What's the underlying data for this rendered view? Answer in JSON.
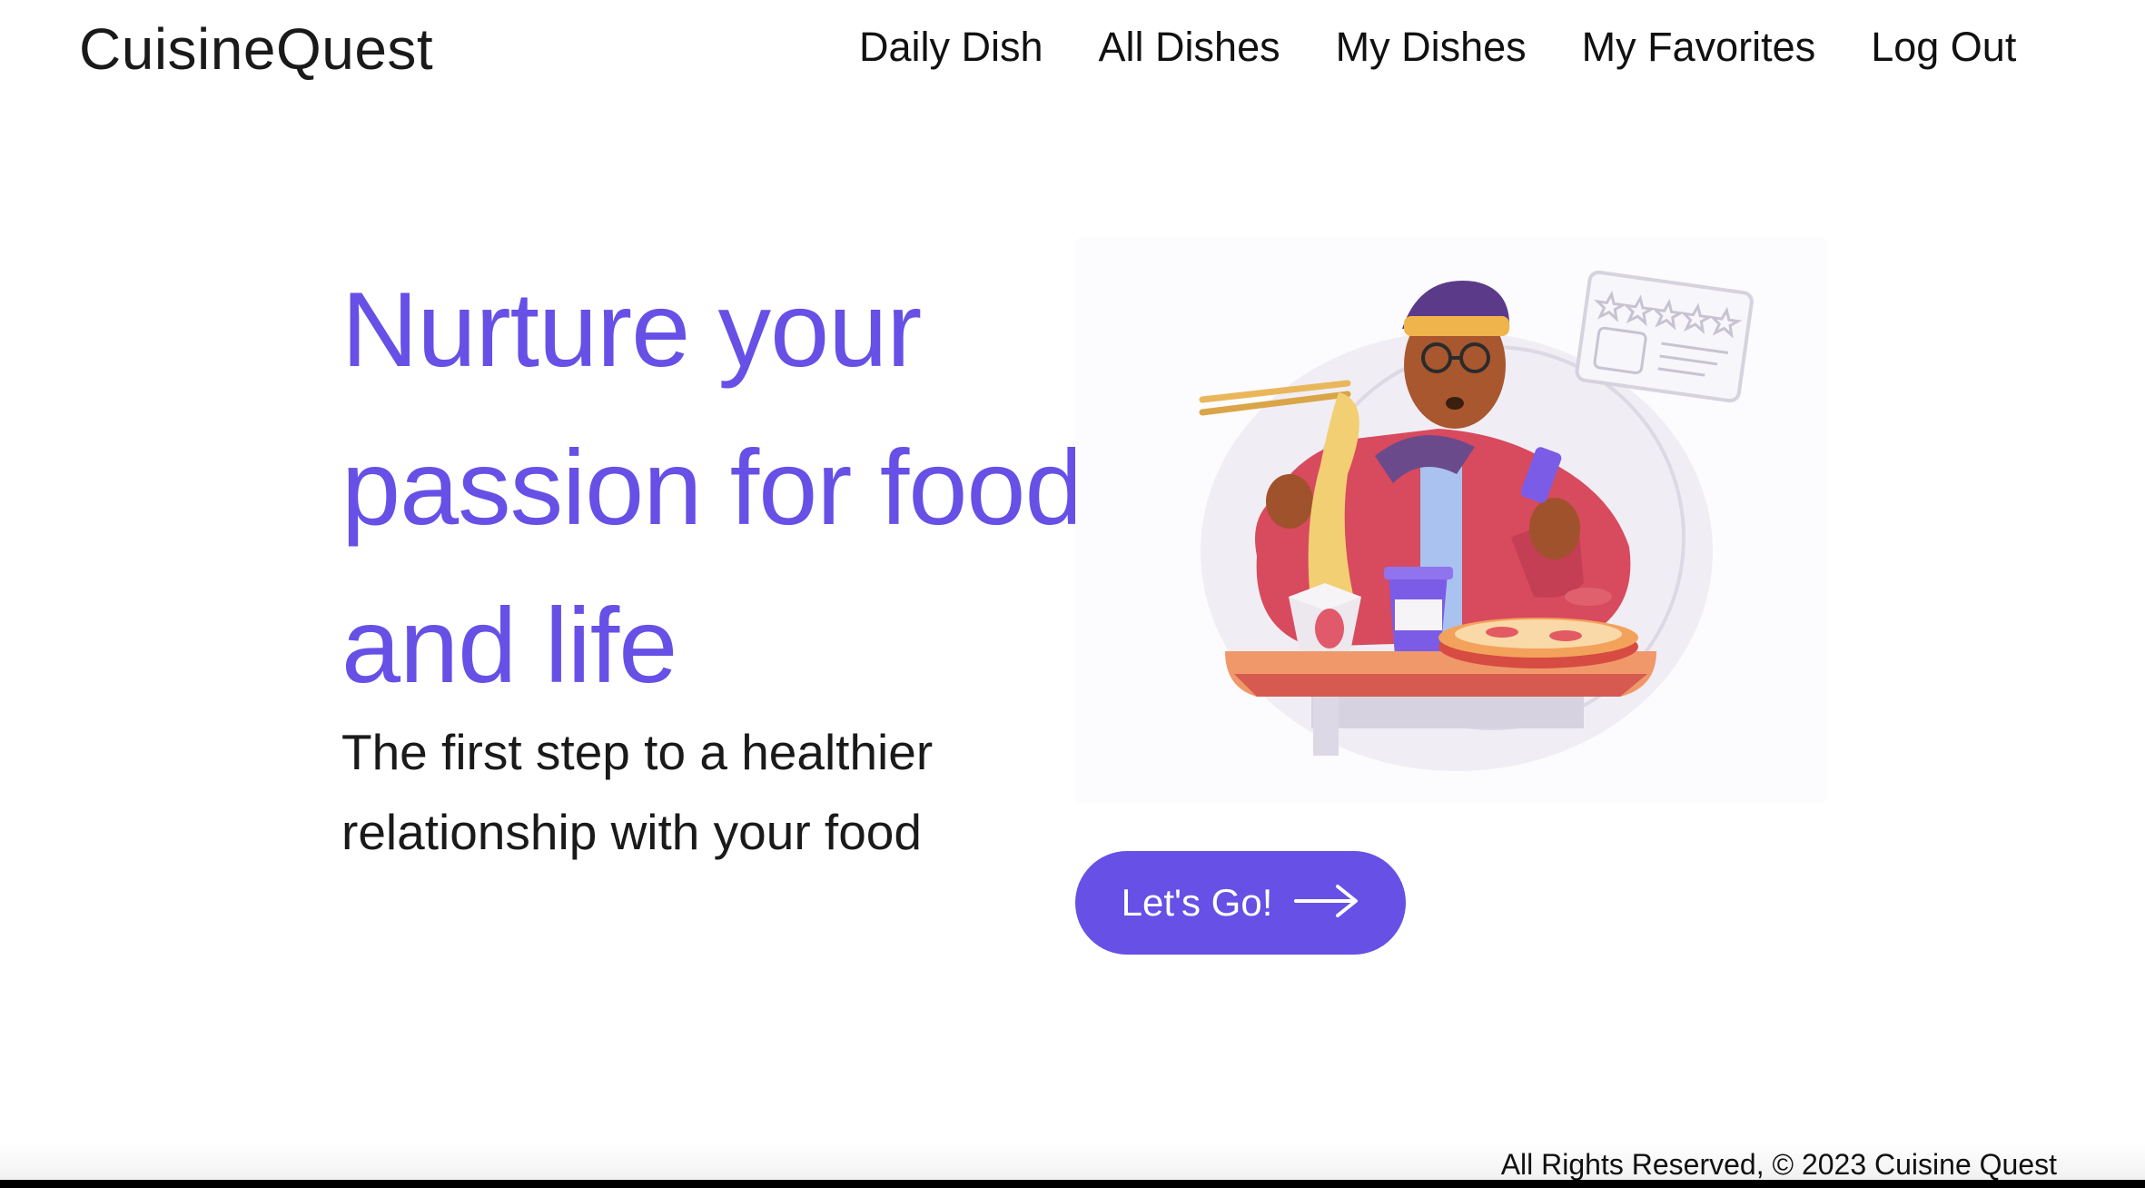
{
  "navbar": {
    "brand": "CuisineQuest",
    "links": [
      {
        "label": "Daily Dish"
      },
      {
        "label": "All Dishes"
      },
      {
        "label": "My Dishes"
      },
      {
        "label": "My Favorites"
      },
      {
        "label": "Log Out"
      }
    ]
  },
  "hero": {
    "title_lines": [
      "Nurture your",
      "passion for food",
      "and life"
    ],
    "subtitle_lines": [
      "The first step to a healthier",
      "relationship with your food"
    ],
    "illustration_icon": "person-eating-noodles-illustration",
    "cta": {
      "label": "Let's Go!",
      "icon": "arrow-right-icon"
    }
  },
  "footer": {
    "text": "All Rights Reserved, © 2023 Cuisine Quest"
  },
  "colors": {
    "accent": "#6650e6",
    "text": "#111111",
    "background": "#ffffff"
  }
}
